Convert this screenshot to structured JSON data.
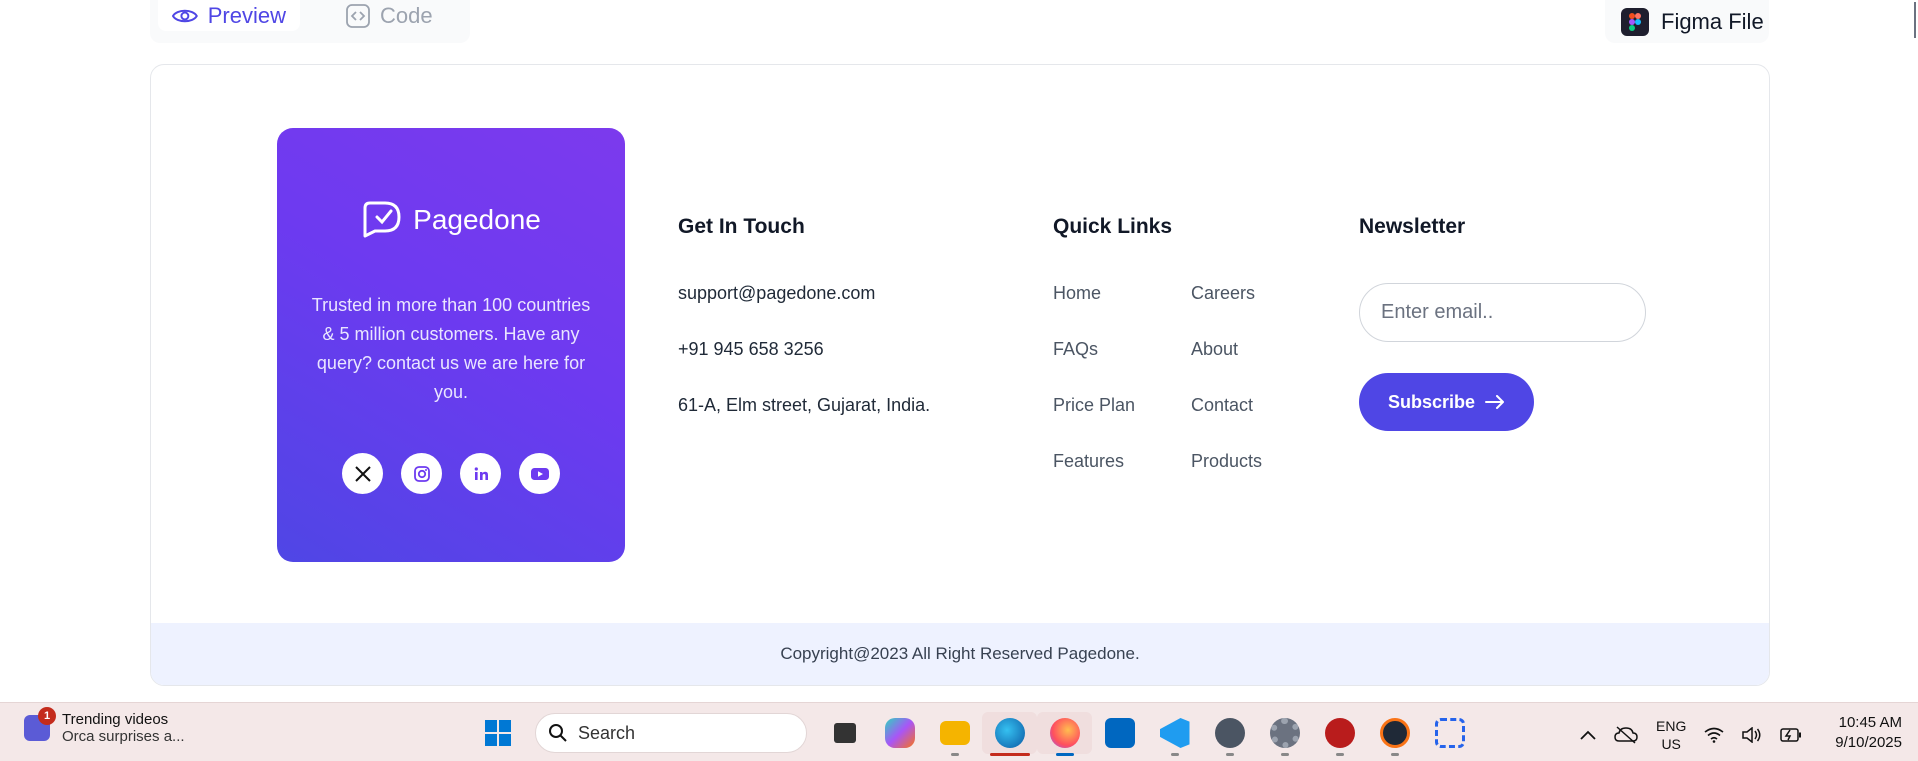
{
  "tabs": {
    "preview": "Preview",
    "code": "Code",
    "figma": "Figma File"
  },
  "brand": {
    "name": "Pagedone",
    "description": "Trusted in more than 100 countries & 5 million customers. Have any query? contact us we are here for you.",
    "socials": [
      "X",
      "Instagram",
      "LinkedIn",
      "YouTube"
    ]
  },
  "contact": {
    "title": "Get In Touch",
    "email": "support@pagedone.com",
    "phone": "+91 945 658 3256",
    "address": "61-A, Elm street, Gujarat, India."
  },
  "quick_links": {
    "title": "Quick Links",
    "col1": [
      "Home",
      "FAQs",
      "Price Plan",
      "Features"
    ],
    "col2": [
      "Careers",
      "About",
      "Contact",
      "Products"
    ]
  },
  "newsletter": {
    "title": "Newsletter",
    "placeholder": "Enter email..",
    "button": "Subscribe"
  },
  "copyright": "Copyright@2023 All Right Reserved Pagedone.",
  "taskbar": {
    "notification": {
      "count": "1",
      "title": "Trending videos",
      "subtitle": "Orca surprises a..."
    },
    "search_placeholder": "Search",
    "lang": "ENG",
    "region": "US",
    "time": "10:45 AM",
    "date": "9/10/2025"
  },
  "colors": {
    "accent": "#4f46e5",
    "gradient_start": "#7c3aed",
    "copyright_bg": "#eef2ff",
    "taskbar_bg": "#f4e8e8"
  }
}
